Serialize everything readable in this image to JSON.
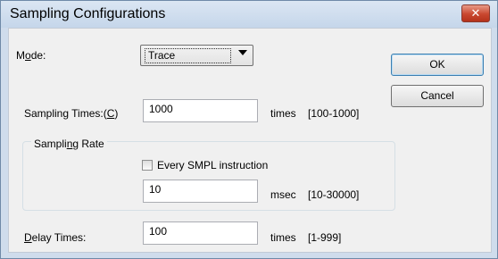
{
  "window": {
    "title": "Sampling Configurations",
    "close_label": "✕"
  },
  "mode": {
    "label_pre": "M",
    "label_ul": "o",
    "label_post": "de:",
    "value": "Trace"
  },
  "buttons": {
    "ok": "OK",
    "cancel": "Cancel"
  },
  "sampling_times": {
    "label": "Sampling Times:(",
    "label_ul": "C",
    "label_post": ")",
    "value": "1000",
    "unit": "times",
    "range": "[100-1000]"
  },
  "sampling_rate": {
    "group_label_pre": "Sampli",
    "group_label_ul": "n",
    "group_label_post": "g Rate",
    "checkbox_label": "Every SMPL instruction",
    "checkbox_checked": false,
    "value": "10",
    "unit": "msec",
    "range": "[10-30000]"
  },
  "delay_times": {
    "label_ul": "D",
    "label_post": "elay Times:",
    "value": "100",
    "unit": "times",
    "range": "[1-999]"
  }
}
